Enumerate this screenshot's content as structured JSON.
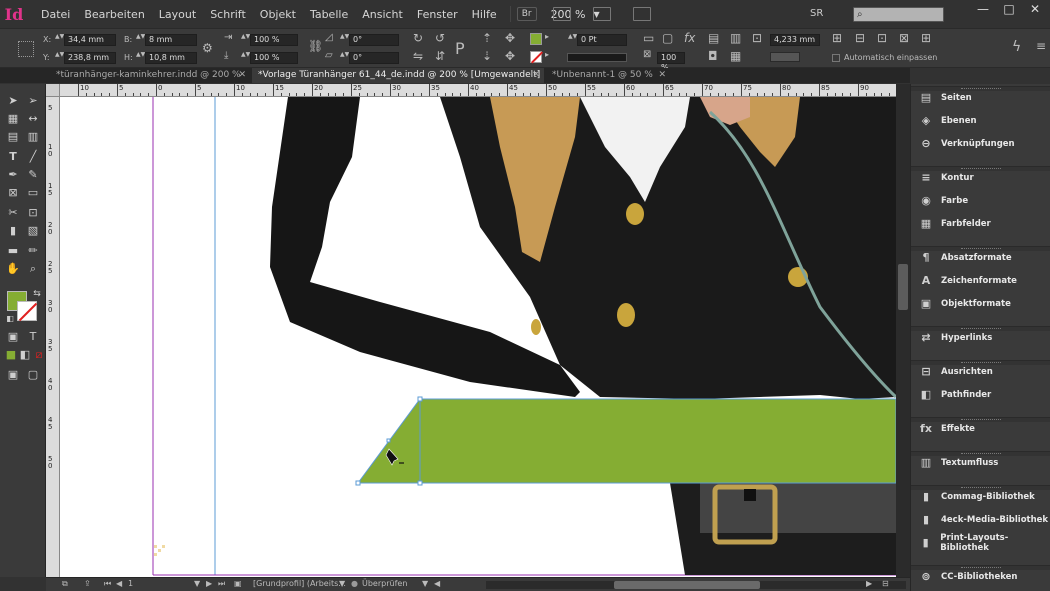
{
  "app": {
    "logo": "Id"
  },
  "menu": [
    "Datei",
    "Bearbeiten",
    "Layout",
    "Schrift",
    "Objekt",
    "Tabelle",
    "Ansicht",
    "Fenster",
    "Hilfe"
  ],
  "bridge_label": "Br",
  "zoom_value": "200 %",
  "user_initials": "SR",
  "search": {
    "placeholder": ""
  },
  "window_controls": {
    "minimize": "—",
    "maximize": "□",
    "close": "✕"
  },
  "control": {
    "x_label": "X:",
    "x_value": "34,4 mm",
    "y_label": "Y:",
    "y_value": "238,8 mm",
    "w_label": "B:",
    "w_value": "8 mm",
    "h_label": "H:",
    "h_value": "10,8 mm",
    "scale_x": "100 %",
    "scale_y": "100 %",
    "rotate": "0°",
    "shear": "0°",
    "stroke_weight": "0 Pt",
    "opacity": "100 %",
    "spacing": "4,233 mm",
    "autofit_label": "Automatisch einpassen",
    "fill_color": "#85ad33"
  },
  "tabs": [
    {
      "label": "*türanhänger-kaminkehrer.indd @ 200 %",
      "active": false
    },
    {
      "label": "*Vorlage Türanhänger 61_44_de.indd @ 200 % [Umgewandelt]",
      "active": true
    },
    {
      "label": "*Unbenannt-1 @ 50 %",
      "active": false
    }
  ],
  "ruler_top": [
    "10",
    "5",
    "0",
    "5",
    "10",
    "15",
    "20",
    "25",
    "30",
    "35",
    "40",
    "45",
    "50",
    "55",
    "60",
    "65",
    "70",
    "75",
    "80",
    "85",
    "90"
  ],
  "ruler_left": [
    "5",
    "1\n0",
    "1\n5",
    "2\n0",
    "2\n5",
    "3\n0",
    "3\n5",
    "4\n0",
    "4\n5",
    "5\n0"
  ],
  "status": {
    "page": "1",
    "profile": "[Grundprofil] (Arbeits...",
    "preflight": "Überprüfen"
  },
  "panels": [
    {
      "icon": "pages-icon",
      "glyph": "▤",
      "label": "Seiten"
    },
    {
      "icon": "layers-icon",
      "glyph": "◈",
      "label": "Ebenen"
    },
    {
      "icon": "links-icon",
      "glyph": "⊖",
      "label": "Verknüpfungen"
    },
    {
      "icon": "stroke-icon",
      "glyph": "≡",
      "label": "Kontur"
    },
    {
      "icon": "color-icon",
      "glyph": "◉",
      "label": "Farbe"
    },
    {
      "icon": "swatches-icon",
      "glyph": "▦",
      "label": "Farbfelder"
    },
    {
      "icon": "paragraph-styles-icon",
      "glyph": "¶",
      "label": "Absatzformate"
    },
    {
      "icon": "character-styles-icon",
      "glyph": "A",
      "label": "Zeichenformate"
    },
    {
      "icon": "object-styles-icon",
      "glyph": "▣",
      "label": "Objektformate"
    },
    {
      "icon": "hyperlinks-icon",
      "glyph": "⇄",
      "label": "Hyperlinks"
    },
    {
      "icon": "align-icon",
      "glyph": "⊟",
      "label": "Ausrichten"
    },
    {
      "icon": "pathfinder-icon",
      "glyph": "◧",
      "label": "Pathfinder"
    },
    {
      "icon": "effects-icon",
      "glyph": "fx",
      "label": "Effekte"
    },
    {
      "icon": "text-wrap-icon",
      "glyph": "▥",
      "label": "Textumfluss"
    },
    {
      "icon": "library-icon",
      "glyph": "▮",
      "label": "Commag-Bibliothek"
    },
    {
      "icon": "library-icon",
      "glyph": "▮",
      "label": "4eck-Media-Bibliothek"
    },
    {
      "icon": "library-icon",
      "glyph": "▮",
      "label": "Print-Layouts-Bibliothek"
    },
    {
      "icon": "cc-libraries-icon",
      "glyph": "⊚",
      "label": "CC-Bibliotheken"
    }
  ]
}
